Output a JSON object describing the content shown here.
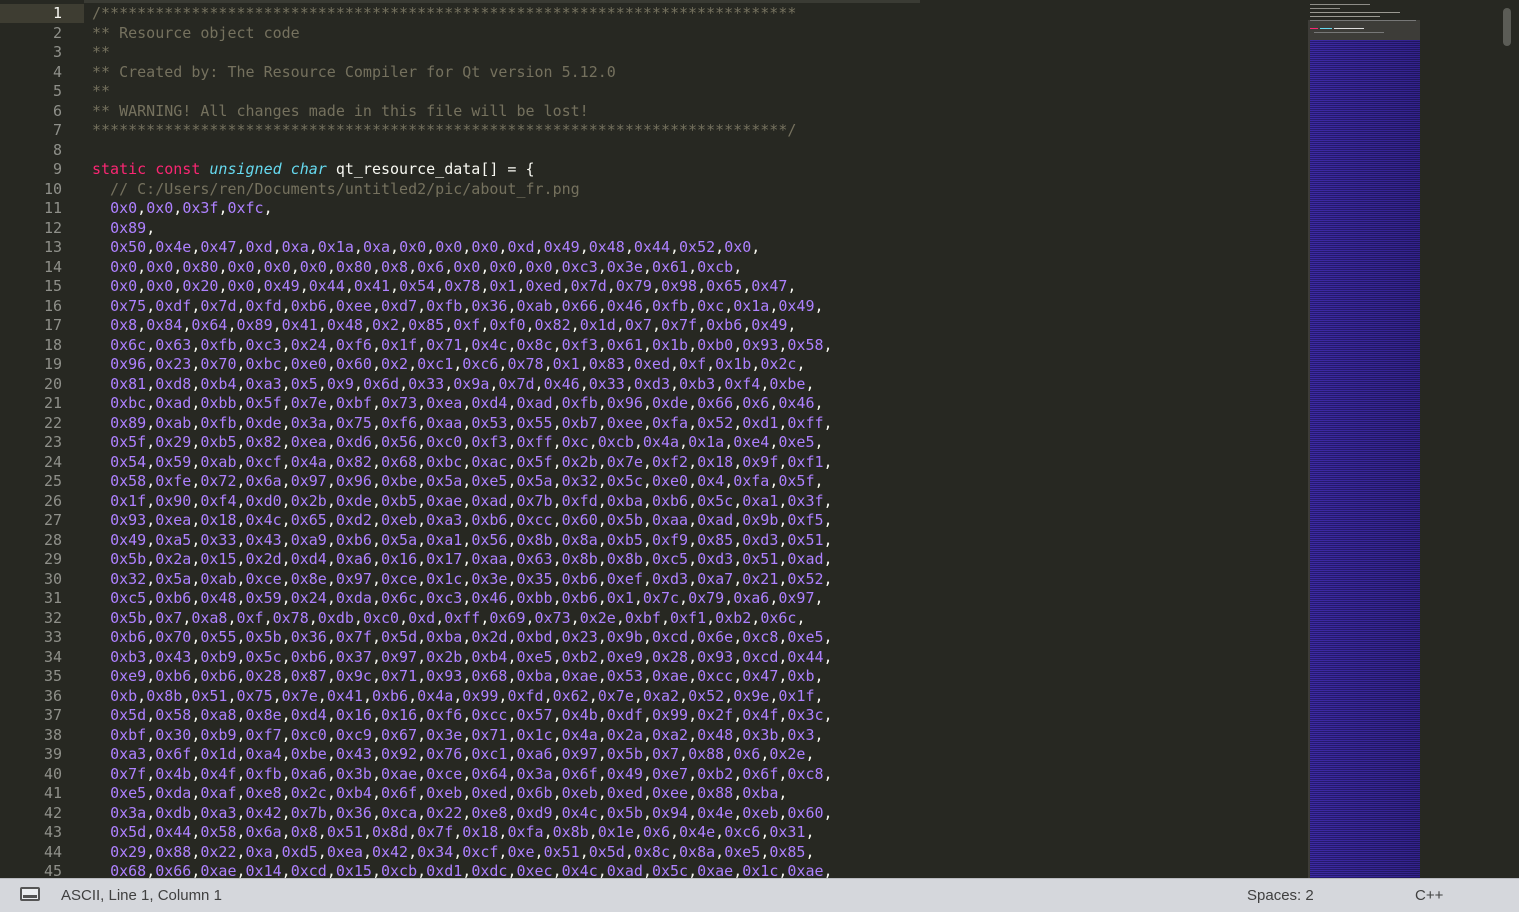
{
  "editor": {
    "line_numbers": [
      "1",
      "2",
      "3",
      "4",
      "5",
      "6",
      "7",
      "8",
      "9",
      "10",
      "11",
      "12",
      "13",
      "14",
      "15",
      "16",
      "17",
      "18",
      "19",
      "20",
      "21",
      "22",
      "23",
      "24",
      "25",
      "26",
      "27",
      "28",
      "29",
      "30",
      "31",
      "32",
      "33",
      "34",
      "35",
      "36",
      "37",
      "38",
      "39",
      "40",
      "41",
      "42",
      "43",
      "44",
      "45"
    ],
    "header_lines": [
      "/*****************************************************************************",
      "** Resource object code",
      "**",
      "** Created by: The Resource Compiler for Qt version 5.12.0",
      "**",
      "** WARNING! All changes made in this file will be lost!",
      "*****************************************************************************/"
    ],
    "decl": {
      "kw_static": "static",
      "kw_const": "const",
      "type_unsigned": "unsigned",
      "type_char": "char",
      "rest": "qt_resource_data[] = {"
    },
    "path_comment": "  // C:/Users/ren/Documents/untitled2/pic/about_fr.png",
    "hex_lines": [
      "0x0,0x0,0x3f,0xfc,",
      "0x89,",
      "0x50,0x4e,0x47,0xd,0xa,0x1a,0xa,0x0,0x0,0x0,0xd,0x49,0x48,0x44,0x52,0x0,",
      "0x0,0x0,0x80,0x0,0x0,0x0,0x80,0x8,0x6,0x0,0x0,0x0,0xc3,0x3e,0x61,0xcb,",
      "0x0,0x0,0x20,0x0,0x49,0x44,0x41,0x54,0x78,0x1,0xed,0x7d,0x79,0x98,0x65,0x47,",
      "0x75,0xdf,0x7d,0xfd,0xb6,0xee,0xd7,0xfb,0x36,0xab,0x66,0x46,0xfb,0xc,0x1a,0x49,",
      "0x8,0x84,0x64,0x89,0x41,0x48,0x2,0x85,0xf,0xf0,0x82,0x1d,0x7,0x7f,0xb6,0x49,",
      "0x6c,0x63,0xfb,0xc3,0x24,0xf6,0x1f,0x71,0x4c,0x8c,0xf3,0x61,0x1b,0xb0,0x93,0x58,",
      "0x96,0x23,0x70,0xbc,0xe0,0x60,0x2,0xc1,0xc6,0x78,0x1,0x83,0xed,0xf,0x1b,0x2c,",
      "0x81,0xd8,0xb4,0xa3,0x5,0x9,0x6d,0x33,0x9a,0x7d,0x46,0x33,0xd3,0xb3,0xf4,0xbe,",
      "0xbc,0xad,0xbb,0x5f,0x7e,0xbf,0x73,0xea,0xd4,0xad,0xfb,0x96,0xde,0x66,0x6,0x46,",
      "0x89,0xab,0xfb,0xde,0x3a,0x75,0xf6,0xaa,0x53,0x55,0xb7,0xee,0xfa,0x52,0xd1,0xff,",
      "0x5f,0x29,0xb5,0x82,0xea,0xd6,0x56,0xc0,0xf3,0xff,0xc,0xcb,0x4a,0x1a,0xe4,0xe5,",
      "0x54,0x59,0xab,0xcf,0x4a,0x82,0x68,0xbc,0xac,0x5f,0x2b,0x7e,0xf2,0x18,0x9f,0xf1,",
      "0x58,0xfe,0x72,0x6a,0x97,0x96,0xbe,0x5a,0xe5,0x5a,0x32,0x5c,0xe0,0x4,0xfa,0x5f,",
      "0x1f,0x90,0xf4,0xd0,0x2b,0xde,0xb5,0xae,0xad,0x7b,0xfd,0xba,0xb6,0x5c,0xa1,0x3f,",
      "0x93,0xea,0x18,0x4c,0x65,0xd2,0xeb,0xa3,0xb6,0xcc,0x60,0x5b,0xaa,0xad,0x9b,0xf5,",
      "0x49,0xa5,0x33,0x43,0xa9,0xb6,0x5a,0xa1,0x56,0x8b,0x8a,0xb5,0xf9,0x85,0xd3,0x51,",
      "0x5b,0x2a,0x15,0x2d,0xd4,0xa6,0x16,0x17,0xaa,0x63,0x8b,0x8b,0xc5,0xd3,0x51,0xad,",
      "0x32,0x5a,0xab,0xce,0x8e,0x97,0xce,0x1c,0x3e,0x35,0xb6,0xef,0xd3,0xa7,0x21,0x52,",
      "0xc5,0xb6,0x48,0x59,0x24,0xda,0x6c,0xc3,0x46,0xbb,0xb6,0x1,0x7c,0x79,0xa6,0x97,",
      "0x5b,0x7,0xa8,0xf,0x78,0xdb,0xc0,0xd,0xff,0x69,0x73,0x2e,0xbf,0xf1,0xb2,0x6c,",
      "0xb6,0x70,0x55,0x5b,0x36,0x7f,0x5d,0xba,0x2d,0xbd,0x23,0x9b,0xcd,0x6e,0xc8,0xe5,",
      "0xb3,0x43,0xb9,0x5c,0xb6,0x37,0x97,0x2b,0xb4,0xe5,0xb2,0xe9,0x28,0x93,0xcd,0x44,",
      "0xe9,0xb6,0xb6,0x28,0x87,0x9c,0x71,0x93,0x68,0xba,0xae,0x53,0xae,0xcc,0x47,0xb,",
      "0xb,0x8b,0x51,0x75,0x7e,0x41,0xb6,0x4a,0x99,0xfd,0x62,0x7e,0xa2,0x52,0x9e,0x1f,",
      "0x5d,0x58,0xa8,0x8e,0xd4,0x16,0x16,0xf6,0xcc,0x57,0x4b,0xdf,0x99,0x2f,0x4f,0x3c,",
      "0xbf,0x30,0xb9,0xf7,0xc0,0xc9,0x67,0x3e,0x71,0x1c,0x4a,0x2a,0xa2,0x48,0x3b,0x3,",
      "0xa3,0x6f,0x1d,0xa4,0xbe,0x43,0x92,0x76,0xc1,0xa6,0x97,0x5b,0x7,0x88,0x6,0x2e,",
      "0x7f,0x4b,0x4f,0xfb,0xa6,0x3b,0xae,0xce,0x64,0x3a,0x6f,0x49,0xe7,0xb2,0x6f,0xc8,",
      "0xe5,0xda,0xaf,0xe8,0x2c,0xb4,0x6f,0xeb,0xed,0x6b,0xeb,0xed,0xee,0x88,0xba,",
      "0x3a,0xdb,0xa3,0x42,0x7b,0x36,0xca,0x22,0xe8,0xd9,0x4c,0x5b,0x94,0x4e,0xeb,0x60,",
      "0x5d,0x44,0x58,0x6a,0x8,0x51,0x8d,0x7f,0x18,0xfa,0x8b,0x1e,0x6,0x4e,0xc6,0x31,",
      "0x29,0x88,0x22,0xa,0xd5,0xea,0x42,0x34,0xcf,0xe,0x51,0x5d,0x8c,0x8a,0xe5,0x85,",
      "0x68,0x66,0xae,0x14,0xcd,0x15,0xcb,0xd1,0xdc,0xec,0x4c,0xad,0x5c,0xae,0x1c,0xae,"
    ]
  },
  "statusbar": {
    "position": "ASCII, Line 1, Column 1",
    "indent": "Spaces: 2",
    "syntax": "C++"
  },
  "colors": {
    "background": "#272822",
    "comment": "#75715e",
    "keyword": "#f92672",
    "type": "#66d9ef",
    "number": "#ae81ff",
    "text": "#f8f8f2",
    "gutter_text": "#8f908a",
    "statusbar_bg": "#d5d7dc"
  }
}
